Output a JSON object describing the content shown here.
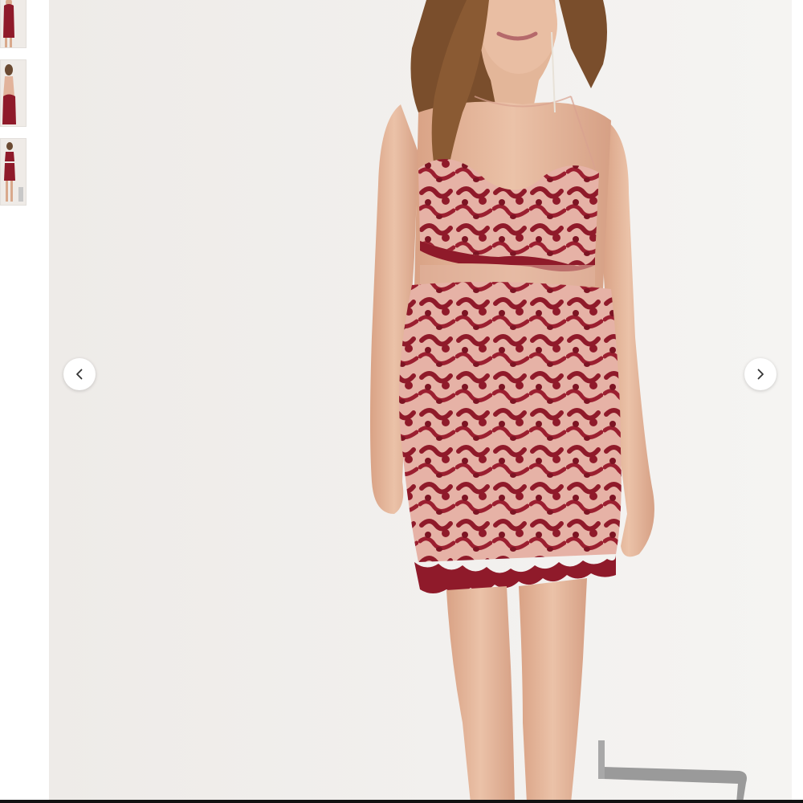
{
  "viewer": {
    "thumbnails": [
      {
        "icon": "dress-front-thumbnail",
        "selected": true
      },
      {
        "icon": "dress-back-thumbnail",
        "selected": false
      },
      {
        "icon": "dress-full-length-thumbnail",
        "selected": false
      }
    ],
    "main_image_icon": "model-wearing-burgundy-lace-two-piece-set",
    "prev_icon": "chevron-left-icon",
    "next_icon": "chevron-right-icon"
  },
  "colors": {
    "accent": "#8f1a2a",
    "lining": "#e9b8ad",
    "background": "#f0eeeb",
    "arrow": "#333333"
  }
}
